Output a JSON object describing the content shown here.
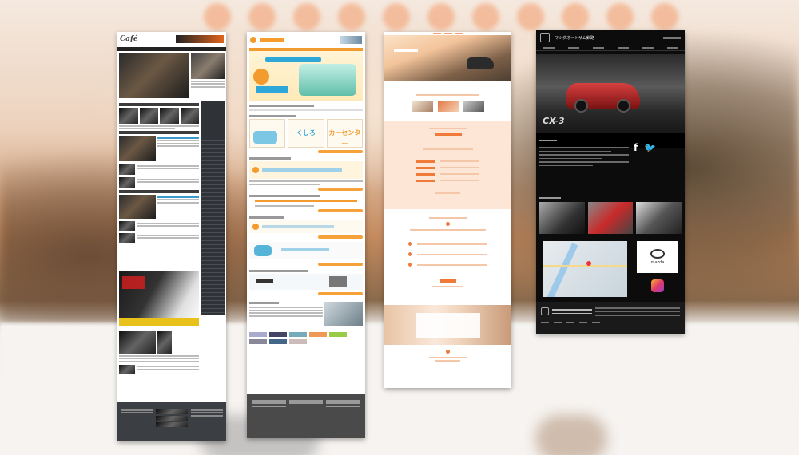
{
  "screens": [
    {
      "id": "motorcycle-magazine",
      "logo": "Café"
    },
    {
      "id": "rental-service",
      "banner_labels": [
        "くしろ",
        "カーセンター"
      ]
    },
    {
      "id": "pale-corporate"
    },
    {
      "id": "dealer-site",
      "title": "マツダオートザム釧路",
      "hero_caption": "CX-3",
      "brand": "mazda"
    }
  ],
  "colors": {
    "orange_accent": "#f39b2e",
    "teal_accent": "#2fa7d8",
    "dark_bg": "#0c0c0c",
    "car_red": "#c92a2a"
  }
}
